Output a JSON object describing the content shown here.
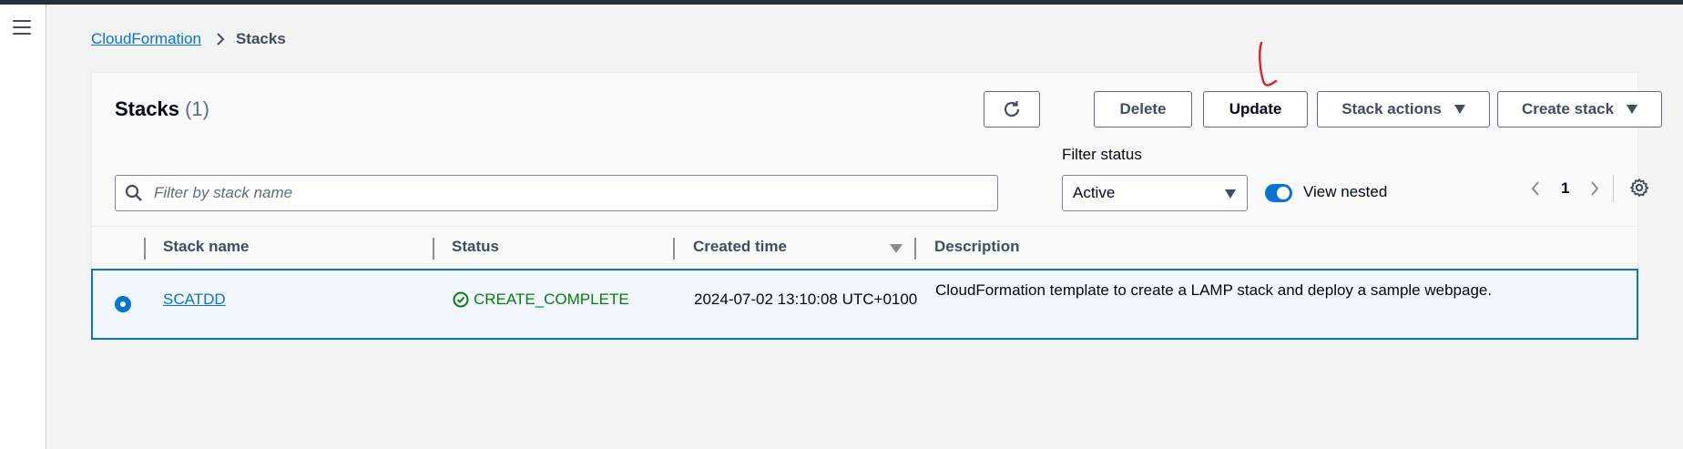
{
  "breadcrumb": {
    "root": "CloudFormation",
    "current": "Stacks"
  },
  "panel": {
    "title": "Stacks",
    "count": "(1)"
  },
  "buttons": {
    "delete": "Delete",
    "update": "Update",
    "stack_actions": "Stack actions",
    "create_stack": "Create stack"
  },
  "search": {
    "placeholder": "Filter by stack name",
    "value": ""
  },
  "filter": {
    "label": "Filter status",
    "selected": "Active"
  },
  "view_nested": {
    "label": "View nested",
    "enabled": true
  },
  "pagination": {
    "current_page": "1"
  },
  "table": {
    "columns": [
      "Stack name",
      "Status",
      "Created time",
      "Description"
    ],
    "rows": [
      {
        "name": "SCATDD",
        "status": "CREATE_COMPLETE",
        "created": "2024-07-02 13:10:08 UTC+0100",
        "description": "CloudFormation template to create a LAMP stack and deploy a sample webpage.",
        "selected": true
      }
    ]
  },
  "colors": {
    "accent": "#0972d3",
    "success": "#037f0c",
    "header_bar": "#232f3e",
    "annotation": "#e02020"
  },
  "icons": [
    "menu-icon",
    "chevron-right-icon",
    "refresh-icon",
    "caret-down-icon",
    "search-icon",
    "chevron-left-icon",
    "settings-gear-icon",
    "check-circle-icon"
  ]
}
